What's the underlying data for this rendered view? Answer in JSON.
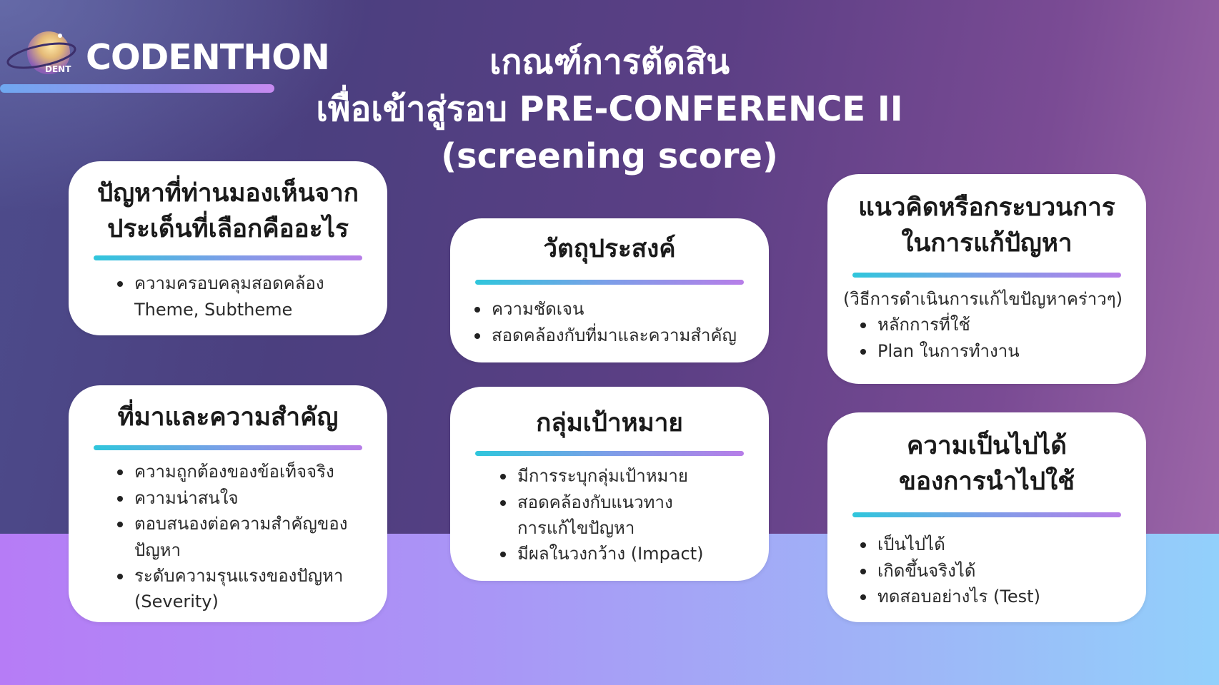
{
  "logo": {
    "name": "CODENTHON",
    "sub": "DENT"
  },
  "title": {
    "line1": "เกณฑ์การตัดสิน",
    "line2": "เพื่อเข้าสู่รอบ PRE-CONFERENCE II",
    "line3": "(screening score)"
  },
  "cards": {
    "problem": {
      "title_line1": "ปัญหาที่ท่านมองเห็นจาก",
      "title_line2": "ประเด็นที่เลือกคืออะไร",
      "items": [
        "ความครอบคลุมสอดคล้อง",
        "Theme, Subtheme"
      ]
    },
    "objective": {
      "title": "วัตถุประสงค์",
      "items": [
        "ความชัดเจน",
        "สอดคล้องกับที่มาและความสำคัญ"
      ]
    },
    "approach": {
      "title_line1": "แนวคิดหรือกระบวนการ",
      "title_line2": "ในการแก้ปัญหา",
      "note": "(วิธีการดำเนินการแก้ไขปัญหาคร่าวๆ)",
      "items": [
        "หลักการที่ใช้",
        "Plan ในการทำงาน"
      ]
    },
    "background": {
      "title": "ที่มาและความสำคัญ",
      "items": [
        "ความถูกต้องของข้อเท็จจริง",
        "ความน่าสนใจ",
        "ตอบสนองต่อความสำคัญของ",
        "ปัญหา",
        "ระดับความรุนแรงของปัญหา",
        "(Severity)"
      ]
    },
    "target": {
      "title": "กลุ่มเป้าหมาย",
      "items": [
        "มีการระบุกลุ่มเป้าหมาย",
        "สอดคล้องกับแนวทาง",
        "การแก้ไขปัญหา",
        "มีผลในวงกว้าง (Impact)"
      ]
    },
    "feasibility": {
      "title_line1": "ความเป็นไปได้",
      "title_line2": "ของการนำไปใช้",
      "items": [
        "เป็นไปได้",
        "เกิดขึ้นจริงได้",
        "ทดสอบอย่างไร (Test)"
      ]
    }
  },
  "colors": {
    "accent_cyan": "#2fc6dc",
    "accent_purple": "#b77ee8",
    "card_bg": "#ffffff",
    "band_left": "#b67cf6",
    "band_right": "#92d0fb"
  }
}
